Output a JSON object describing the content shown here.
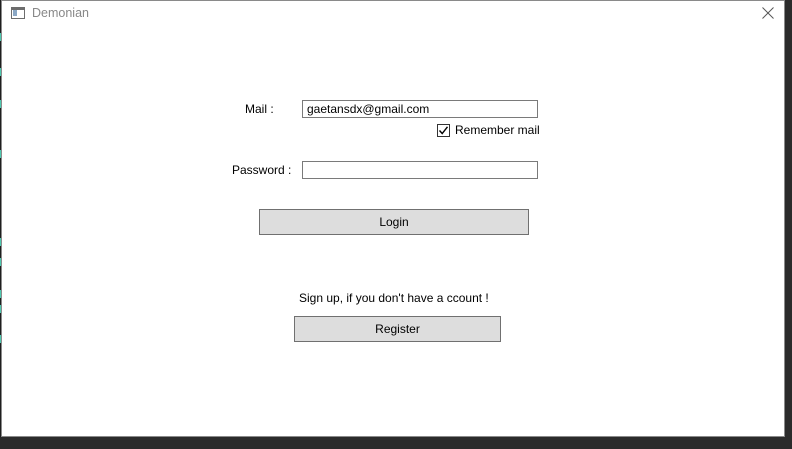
{
  "window": {
    "title": "Demonian"
  },
  "form": {
    "mail_label": "Mail :",
    "mail_value": "gaetansdx@gmail.com",
    "remember_label": "Remember mail",
    "remember_checked": true,
    "password_label": "Password :",
    "password_value": "",
    "login_label": "Login",
    "signup_text": "Sign up, if you don't have a ccount !",
    "register_label": "Register"
  },
  "icons": {
    "app": "app-window-icon",
    "close": "close-icon",
    "check": "checkmark-icon"
  },
  "colors": {
    "button_bg": "#dddddd",
    "border": "#7a7a7a",
    "title_text": "#888888"
  }
}
